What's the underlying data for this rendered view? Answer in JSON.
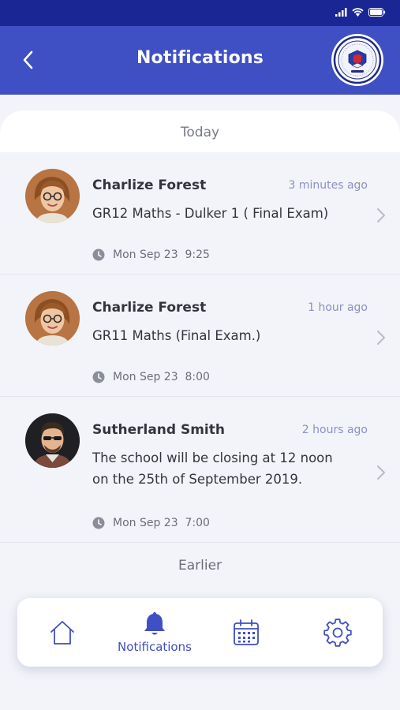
{
  "header": {
    "title": "Notifications"
  },
  "sections": {
    "today": "Today",
    "earlier": "Earlier"
  },
  "notifications": [
    {
      "sender": "Charlize Forest",
      "time_ago": "3 minutes ago",
      "message_lines": [
        "GR12 Maths - Dulker 1 ( Final Exam)"
      ],
      "date": "Mon Sep 23  9:25"
    },
    {
      "sender": "Charlize Forest",
      "time_ago": "1 hour ago",
      "message_lines": [
        "GR11 Maths (Final Exam.)"
      ],
      "date": "Mon Sep 23  8:00"
    },
    {
      "sender": "Sutherland Smith",
      "time_ago": "2 hours ago",
      "message_lines": [
        "The school will be closing at 12 noon",
        "on the 25th of September 2019."
      ],
      "date": "Mon Sep 23  7:00"
    }
  ],
  "bottom_nav": {
    "items": [
      {
        "icon": "home-icon",
        "label": ""
      },
      {
        "icon": "bell-icon",
        "label": "Notifications",
        "active": true
      },
      {
        "icon": "calendar-icon",
        "label": ""
      },
      {
        "icon": "gear-icon",
        "label": ""
      }
    ]
  },
  "colors": {
    "status_bar": "#1a2694",
    "header": "#3f4fc4",
    "accent": "#3f4fc4",
    "time_ago": "#8a90c2",
    "background": "#f3f4f9"
  }
}
